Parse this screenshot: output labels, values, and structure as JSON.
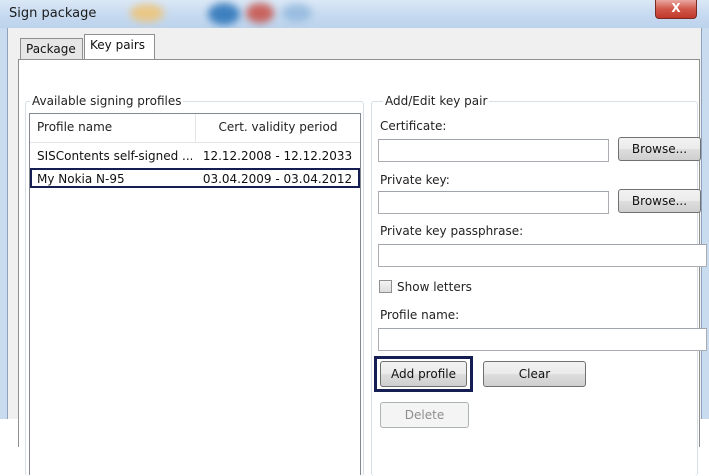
{
  "window": {
    "title": "Sign package",
    "close_glyph": "X"
  },
  "tabs": [
    {
      "label": "Package",
      "selected": false
    },
    {
      "label": "Key pairs",
      "selected": true
    }
  ],
  "profiles": {
    "legend": "Available signing profiles",
    "columns": [
      "Profile name",
      "Cert. validity period"
    ],
    "rows": [
      {
        "name": "SISContents self-signed ...",
        "period": "12.12.2008 - 12.12.2033",
        "selected": false
      },
      {
        "name": "My Nokia N-95",
        "period": "03.04.2009 - 03.04.2012",
        "selected": true
      }
    ]
  },
  "edit": {
    "legend": "Add/Edit key pair",
    "certificate_label": "Certificate:",
    "certificate_value": "",
    "private_key_label": "Private key:",
    "private_key_value": "",
    "passphrase_label": "Private key passphrase:",
    "passphrase_value": "",
    "show_letters_label": "Show letters",
    "show_letters_checked": false,
    "profile_name_label": "Profile name:",
    "profile_name_value": "",
    "browse_label": "Browse...",
    "add_profile_label": "Add profile",
    "clear_label": "Clear",
    "delete_label": "Delete"
  },
  "colors": {
    "title_bar": "#c6daf0",
    "close_button": "#c0392b",
    "highlight_border": "#141e52"
  }
}
